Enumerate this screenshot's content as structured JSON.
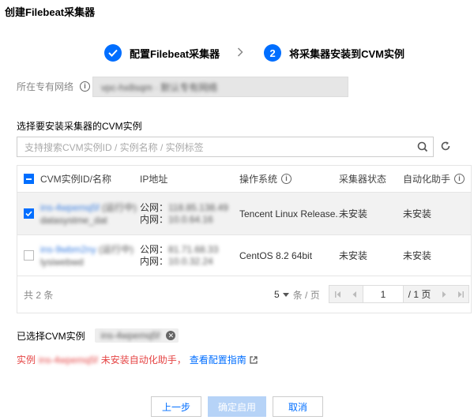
{
  "dialog": {
    "title": "创建Filebeat采集器"
  },
  "steps": [
    {
      "label": "配置Filebeat采集器",
      "status": "done",
      "icon": "check-icon"
    },
    {
      "number": "2",
      "label": "将采集器安装到CVM实例",
      "status": "active"
    }
  ],
  "vpc": {
    "label": "所在专有网络",
    "value": "vpc-hx8sqm · 默认专有网络"
  },
  "instance_select": {
    "title": "选择要安装采集器的CVM实例",
    "search_placeholder": "支持搜索CVM实例ID / 实例名称 / 实例标签"
  },
  "table": {
    "columns": [
      "CVM实例ID/名称",
      "IP地址",
      "操作系统",
      "采集器状态",
      "自动化助手"
    ],
    "rows": [
      {
        "checked": true,
        "id": "ins-4wpemq5f",
        "tag": "(运行中)",
        "name": "datasystme_dat",
        "public_label": "公网：",
        "public_ip": "118.85.138.49",
        "private_label": "内网：",
        "private_ip": "10.0.64.16",
        "os": "Tencent Linux Release...",
        "collector_status": "未安装",
        "helper": "未安装"
      },
      {
        "checked": false,
        "id": "ins-9wbm2ny",
        "tag": "(运行中)",
        "name": "lysiwebwd",
        "public_label": "公网：",
        "public_ip": "81.71.68.33",
        "private_label": "内网：",
        "private_ip": "10.0.32.24",
        "os": "CentOS 8.2 64bit",
        "collector_status": "未安装",
        "helper": "未安装"
      }
    ],
    "pager": {
      "total": "共 2 条",
      "page_size": "5",
      "page_size_unit": "条 / 页",
      "page": "1",
      "page_total": "/ 1 页"
    }
  },
  "selected": {
    "label": "已选择CVM实例",
    "tag": "ins-4wpemq5f"
  },
  "warning": {
    "prefix": "实例",
    "instance": "ins-4wpemq5f",
    "text": "未安装自动化助手，",
    "link": "查看配置指南"
  },
  "footer": {
    "prev": "上一步",
    "confirm": "确定启用",
    "cancel": "取消"
  },
  "colors": {
    "accent": "#006eff",
    "warning": "#e54545",
    "disabled_button": "#b6d3f7"
  }
}
